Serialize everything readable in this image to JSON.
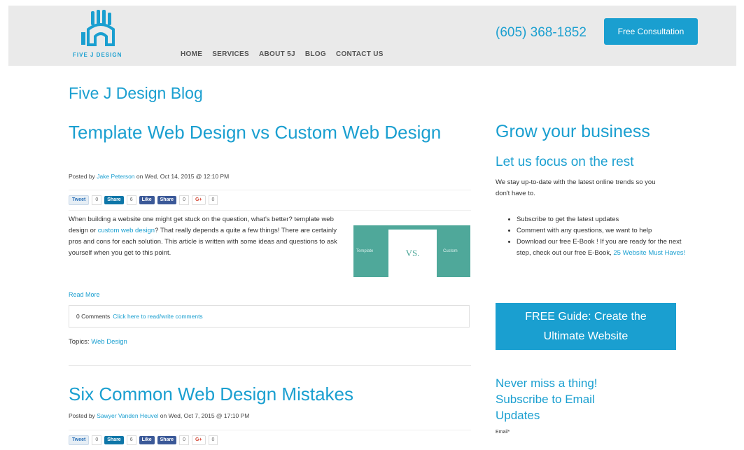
{
  "header": {
    "logo_text": "FIVE J DESIGN",
    "nav": [
      "HOME",
      "SERVICES",
      "ABOUT 5J",
      "BLOG",
      "CONTACT US"
    ],
    "phone": "(605) 368-1852",
    "cta_label": "Free Consultation"
  },
  "blog": {
    "title": "Five J Design Blog"
  },
  "post1": {
    "title": "Template Web Design vs Custom Web Design",
    "meta_prefix": "Posted by",
    "author": "Jake Peterson",
    "meta_suffix": "on Wed, Oct 14, 2015 @ 12:10 PM",
    "share": {
      "tweet": "Tweet",
      "tweet_count": "0",
      "linkedin": "Share",
      "linkedin_count": "6",
      "fb_like": "Like",
      "fb_share": "Share",
      "fb_count": "0",
      "gplus": "G+",
      "gplus_count": "0"
    },
    "excerpt_1": "When building a website one might get stuck on the question, what's better? template web design or",
    "excerpt_link": "custom web design",
    "excerpt_2": "? That really depends a quite a few things! There are certainly pros and cons for each solution. This article is written with some ideas and questions to ask yourself when you get to this point.",
    "thumb_left": "Template",
    "thumb_center": "VS.",
    "thumb_right": "Custom",
    "read_more": "Read More",
    "comments_count": "0 Comments",
    "comments_link": "Click here to read/write comments",
    "topics_label": "Topics:",
    "topic": "Web Design"
  },
  "post2": {
    "title": "Six Common Web Design Mistakes",
    "meta_prefix": "Posted by",
    "author": "Sawyer Vanden Heuvel",
    "meta_suffix": "on Wed, Oct 7, 2015 @ 17:10 PM",
    "share": {
      "tweet": "Tweet",
      "tweet_count": "0",
      "linkedin": "Share",
      "linkedin_count": "6",
      "fb_like": "Like",
      "fb_share": "Share",
      "fb_count": "0",
      "gplus": "G+",
      "gplus_count": "0"
    }
  },
  "sidebar": {
    "heading": "Grow your business",
    "subheading": "Let us focus on the rest",
    "intro": "We stay up-to-date with the latest online trends so you don't have to.",
    "list": [
      "Subscribe to get the latest updates",
      "Comment with any questions, we want to help",
      "Download our free E-Book ! If you are ready for the next step, check out our free E-Book,"
    ],
    "ebook_link": "25 Website Must Haves!",
    "guide_line1": "FREE Guide: Create the",
    "guide_line2": "Ultimate Website",
    "subscribe_heading": "Never miss a thing! Subscribe to Email Updates",
    "email_label": "Email*"
  },
  "colors": {
    "brand": "#1a9fd0",
    "header_bg": "#eaeaea",
    "thumb_teal": "#4fa89a"
  }
}
